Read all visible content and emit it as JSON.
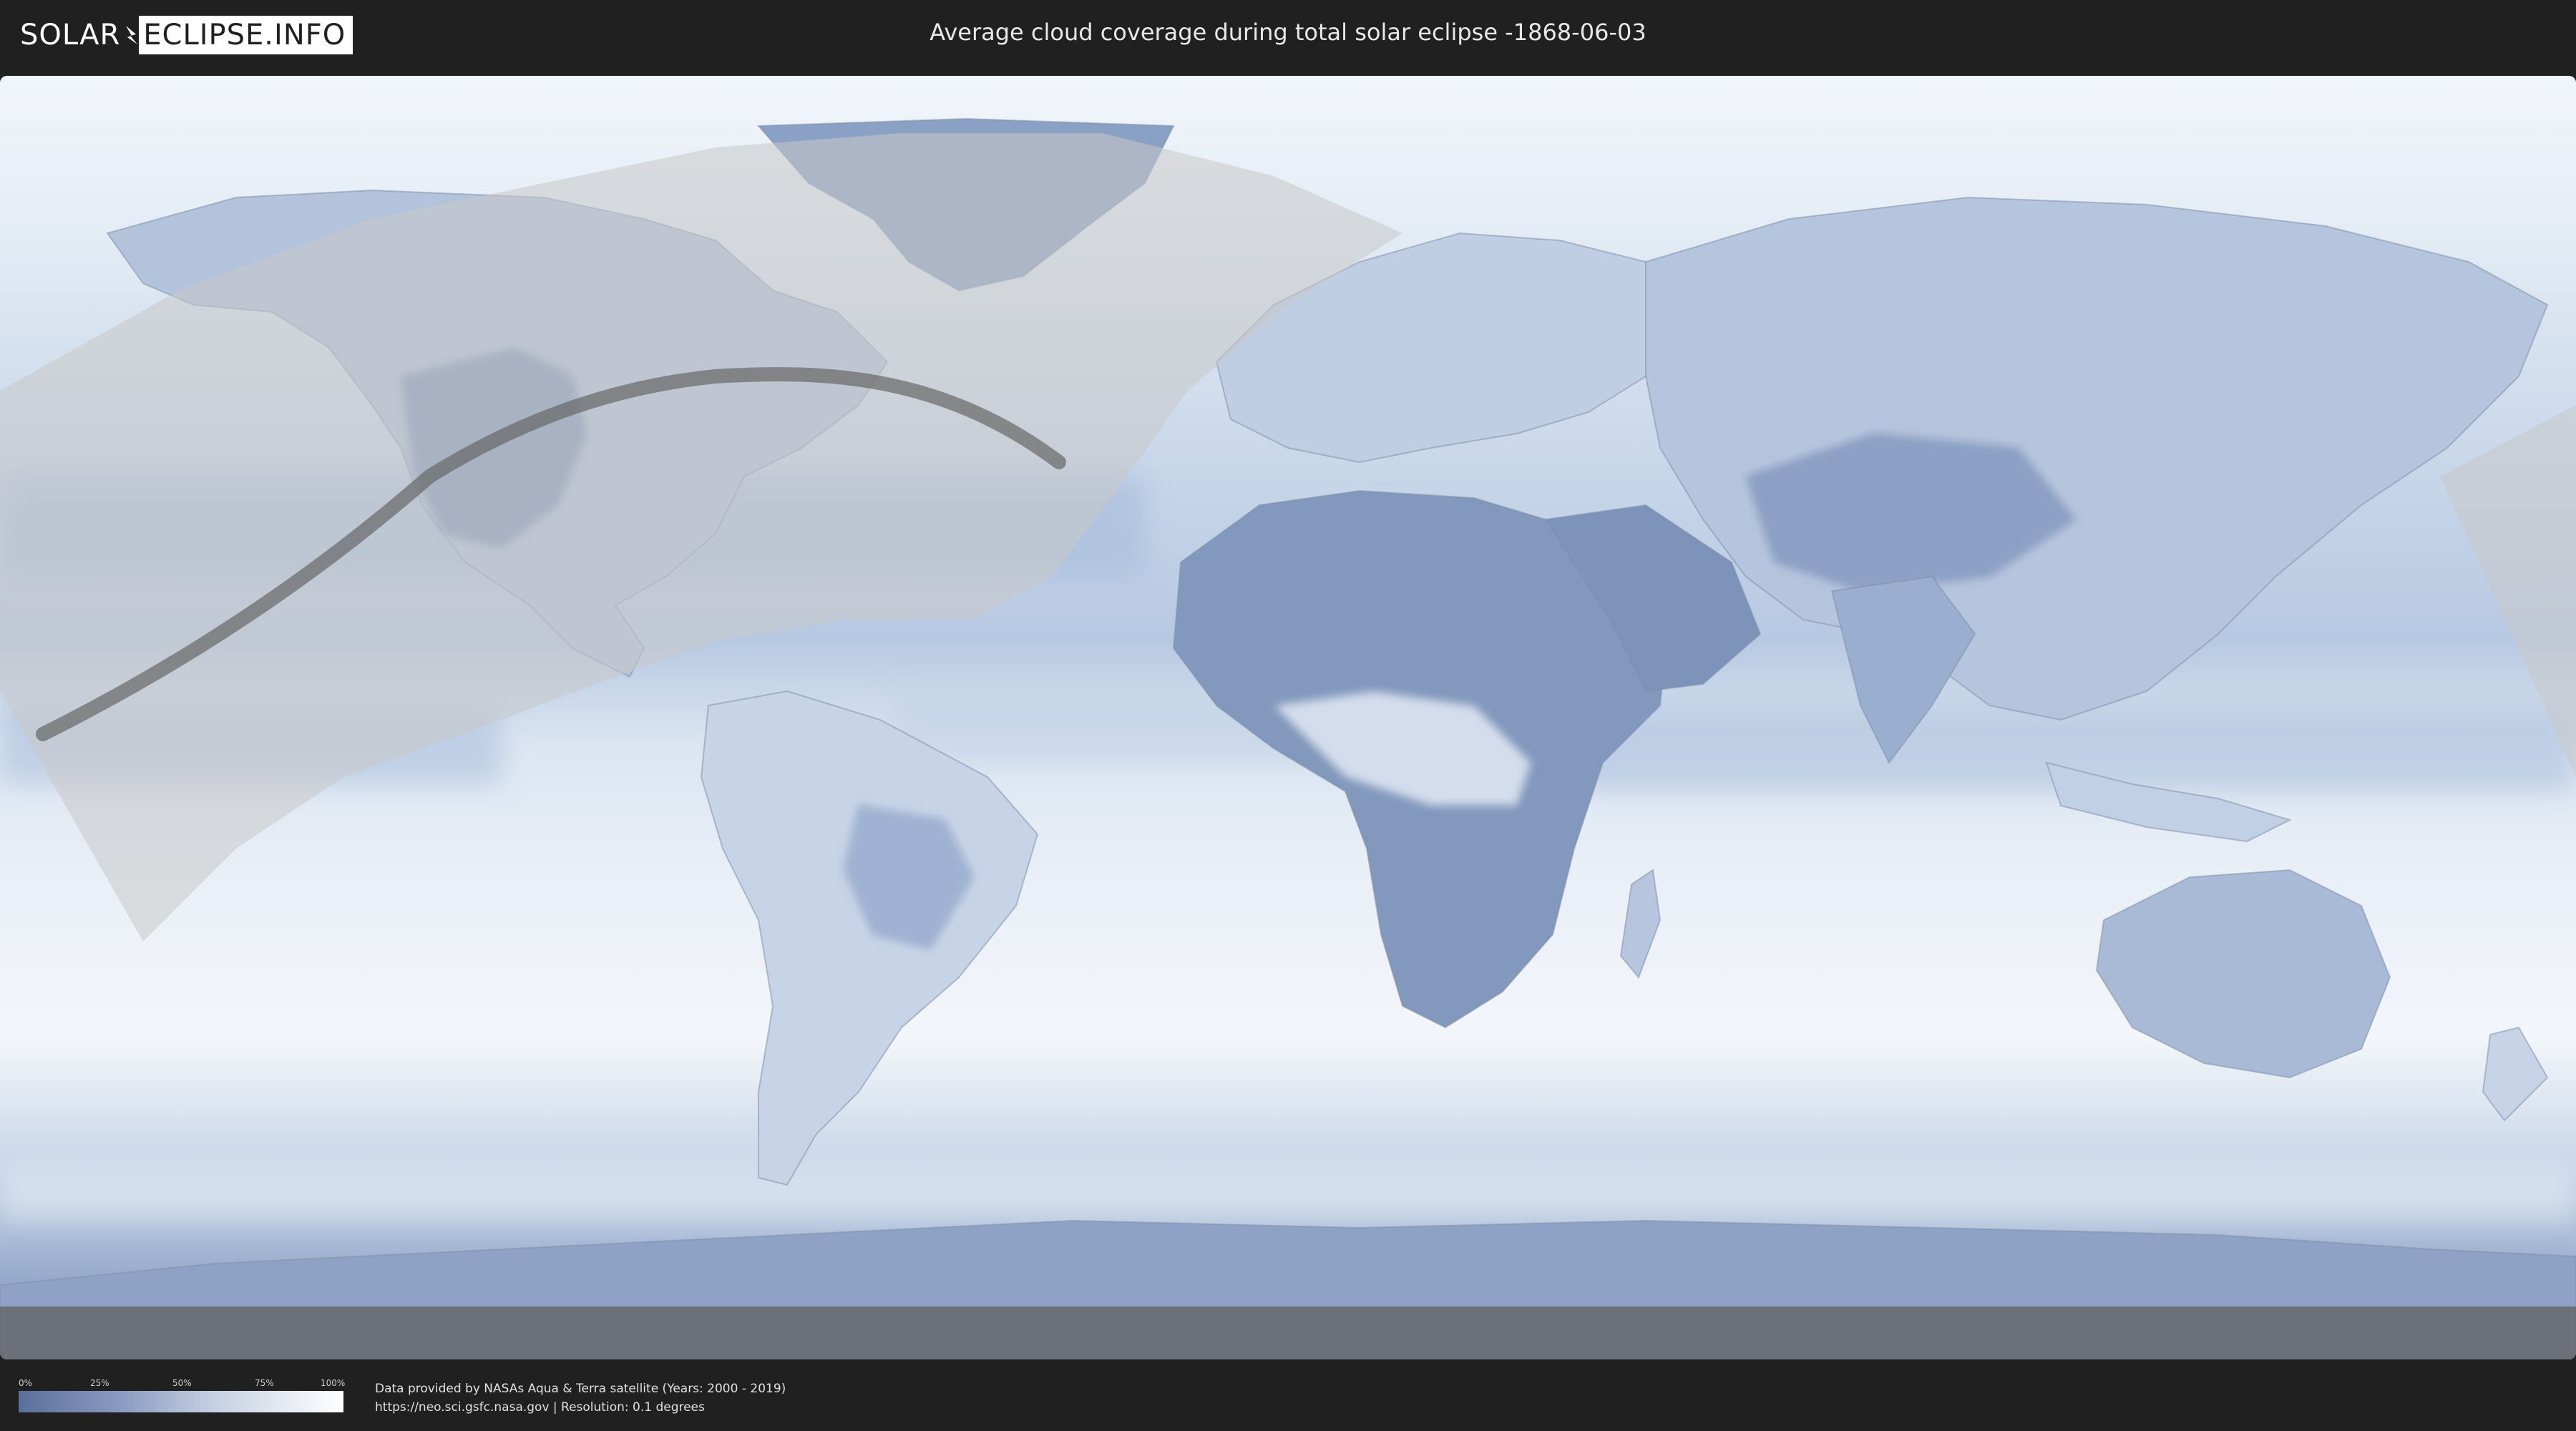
{
  "header": {
    "logo_left": "SOLAR",
    "logo_right": "ECLIPSE.INFO",
    "title": "Average cloud coverage during total solar eclipse -1868-06-03"
  },
  "legend": {
    "ticks": [
      "0%",
      "25%",
      "50%",
      "75%",
      "100%"
    ],
    "colors": {
      "low": "#5b6f9c",
      "high": "#ffffff"
    }
  },
  "credits": {
    "line1": "Data provided by NASAs Aqua & Terra satellite (Years: 2000 - 2019)",
    "line2": "https://neo.sci.gsfc.nasa.gov | Resolution: 0.1 degrees"
  },
  "colors": {
    "background": "#202020",
    "cloud_clear": "#5b74a8",
    "cloud_full": "#ffffff",
    "eclipse_shade": "#c9c9c9",
    "eclipse_path": "#555555"
  }
}
